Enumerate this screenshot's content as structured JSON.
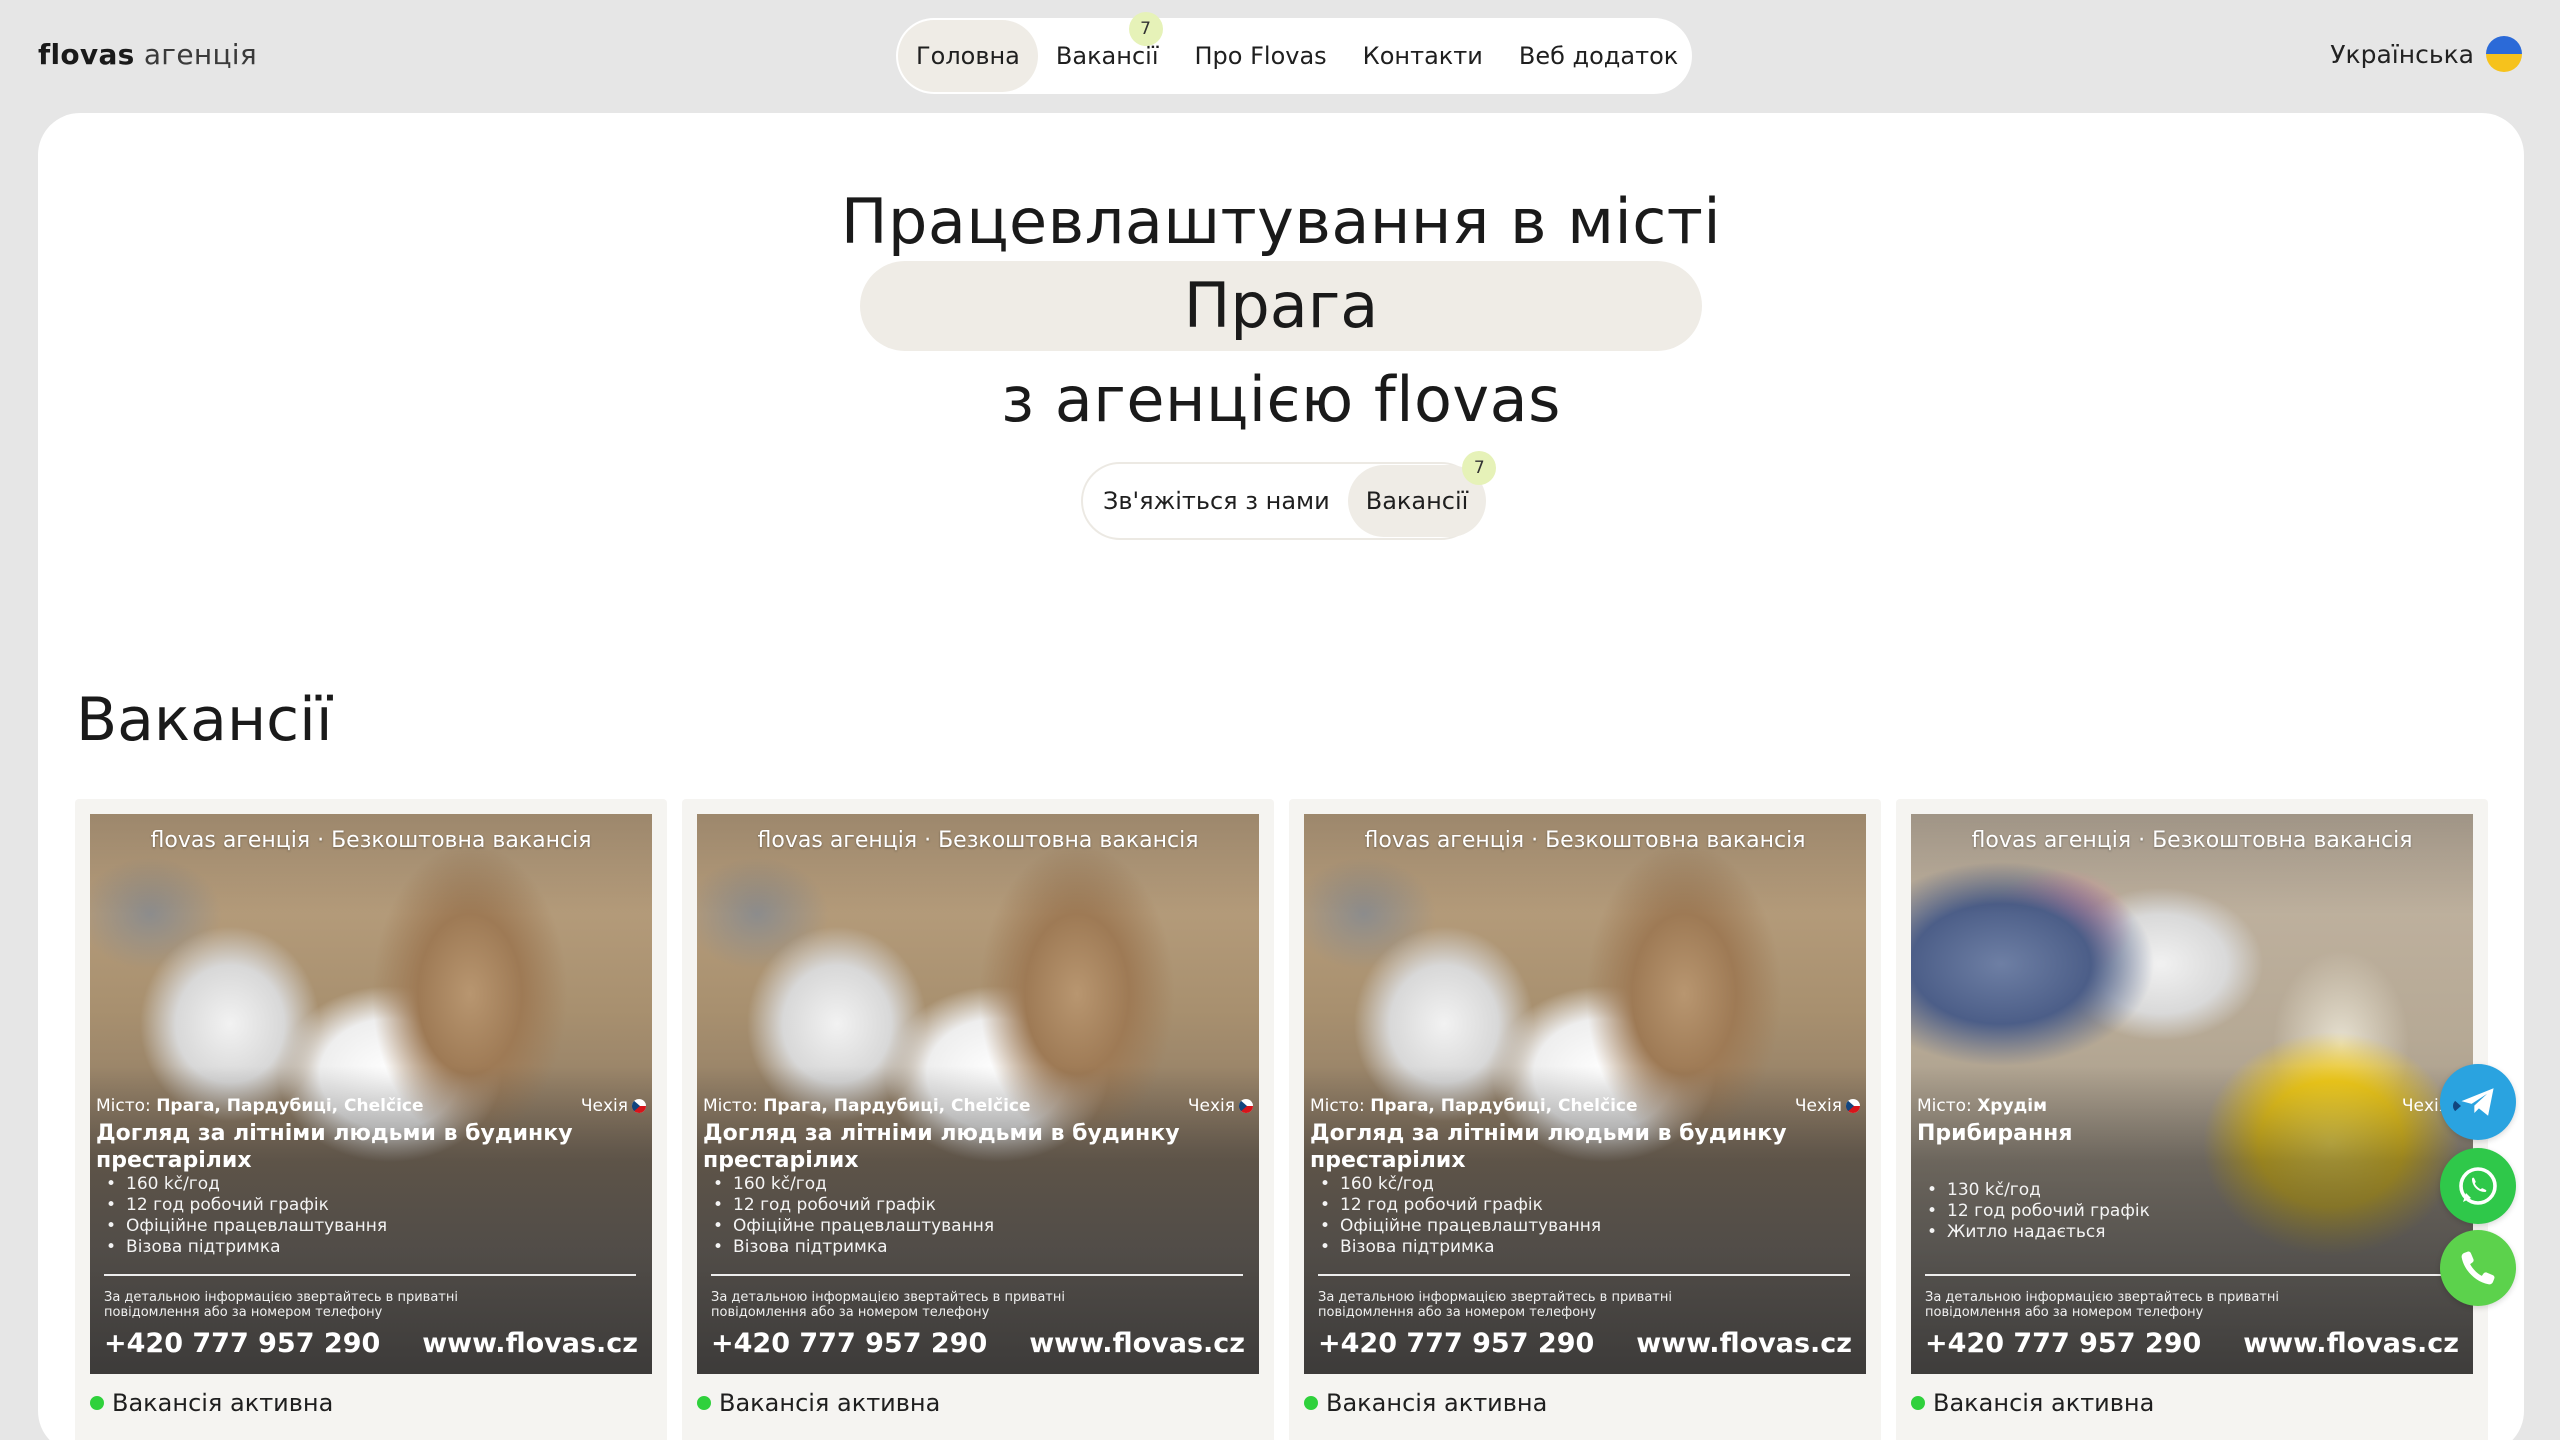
{
  "header": {
    "logo_brand": "flovas",
    "logo_suffix": "агенція",
    "nav": [
      {
        "label": "Головна"
      },
      {
        "label": "Вакансії",
        "badge": "7"
      },
      {
        "label": "Про Flovas"
      },
      {
        "label": "Контакти"
      },
      {
        "label": "Веб додаток"
      }
    ],
    "language": "Українська",
    "language_flag_colors": [
      "#2b6ad8",
      "#f6c21c"
    ]
  },
  "hero": {
    "line1": "Працевлаштування в місті",
    "city": "Прага",
    "line3": "з агенцією flovas",
    "contact_button": "Зв'яжіться з нами",
    "vacancies_button": "Вакансії",
    "vacancies_badge": "7"
  },
  "vacancies": {
    "title": "Вакансії",
    "cards": [
      {
        "banner": "flovas агенція · Безкоштовна вакансія",
        "city_label": "Місто:",
        "city": "Прага, Пардубиці, Chelčice",
        "country": "Чехія",
        "title": "Догляд за літніми людьми в будинку престарілих",
        "bullets": [
          "160 kč/год",
          "12 год робочий графік",
          "Офіційне працевлаштування",
          "Візова підтримка"
        ],
        "note": "За детальною інформацією звертайтесь в приватні повідомлення або за номером телефону",
        "phone": "+420 777 957 290",
        "site": "www.flovas.cz",
        "status": "Вакансія активна"
      },
      {
        "banner": "flovas агенція · Безкоштовна вакансія",
        "city_label": "Місто:",
        "city": "Прага, Пардубиці, Chelčice",
        "country": "Чехія",
        "title": "Догляд за літніми людьми в будинку престарілих",
        "bullets": [
          "160 kč/год",
          "12 год робочий графік",
          "Офіційне працевлаштування",
          "Візова підтримка"
        ],
        "note": "За детальною інформацією звертайтесь в приватні повідомлення або за номером телефону",
        "phone": "+420 777 957 290",
        "site": "www.flovas.cz",
        "status": "Вакансія активна"
      },
      {
        "banner": "flovas агенція · Безкоштовна вакансія",
        "city_label": "Місто:",
        "city": "Прага, Пардубиці, Chelčice",
        "country": "Чехія",
        "title": "Догляд за літніми людьми в будинку престарілих",
        "bullets": [
          "160 kč/год",
          "12 год робочий графік",
          "Офіційне працевлаштування",
          "Візова підтримка"
        ],
        "note": "За детальною інформацією звертайтесь в приватні повідомлення або за номером телефону",
        "phone": "+420 777 957 290",
        "site": "www.flovas.cz",
        "status": "Вакансія активна"
      },
      {
        "banner": "flovas агенція · Безкоштовна вакансія",
        "city_label": "Місто:",
        "city": "Хрудім",
        "country": "Чехія",
        "title": "Прибирання",
        "bullets": [
          "130 kč/год",
          "12 год робочий графік",
          "Житло надається"
        ],
        "note": "За детальною інформацією звертайтесь в приватні повідомлення або за номером телефону",
        "phone": "+420 777 957 290",
        "site": "www.flovas.cz",
        "status": "Вакансія активна"
      }
    ]
  },
  "floating": {
    "telegram_icon": "telegram-icon",
    "whatsapp_icon": "whatsapp-icon",
    "phone_icon": "phone-icon"
  },
  "colors": {
    "active_status": "#2fd13c",
    "badge": "#e6f2b8",
    "pill": "#efece6"
  }
}
